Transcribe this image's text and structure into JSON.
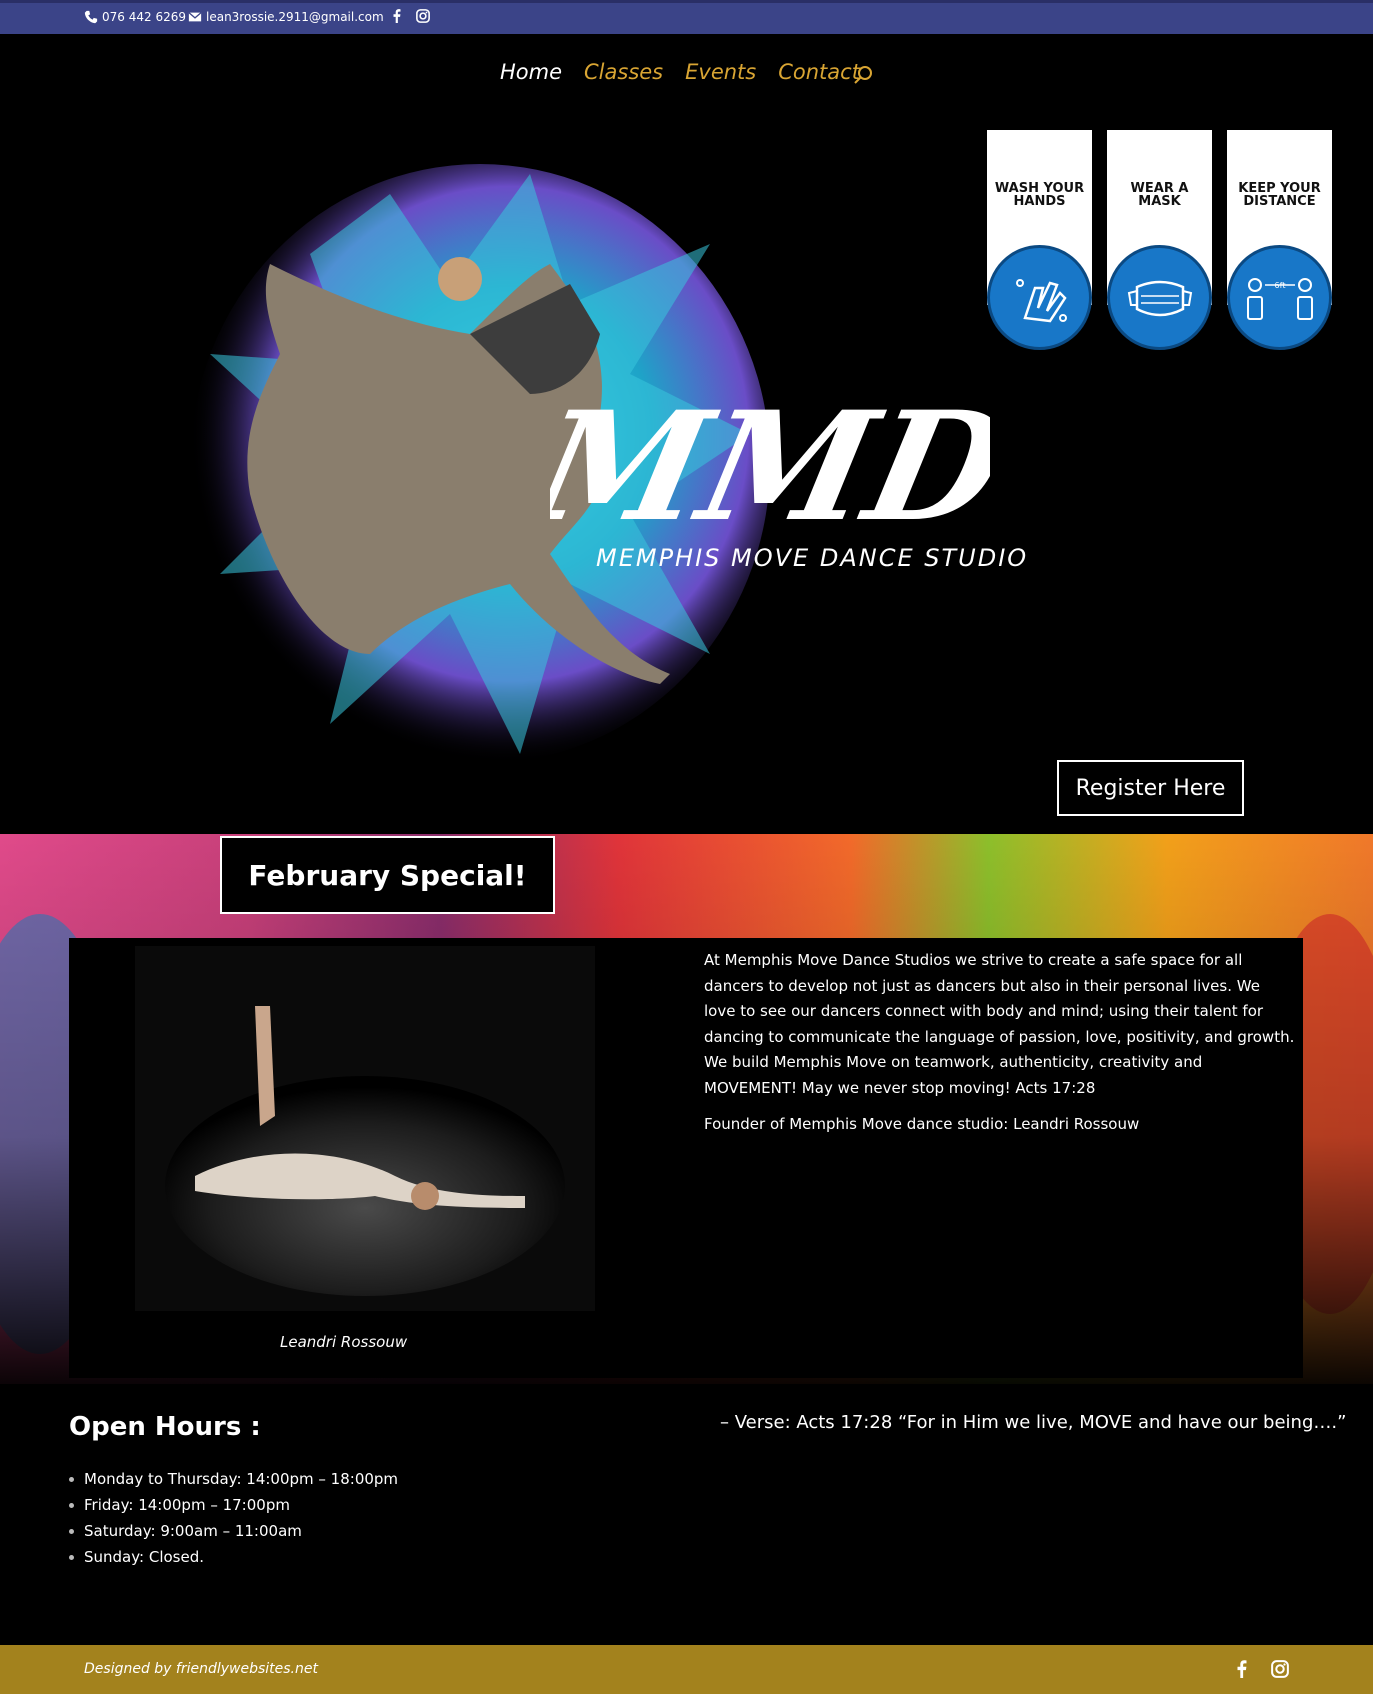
{
  "topbar": {
    "phone": "076 442 6269",
    "email": "lean3rossie.2911@gmail.com",
    "icons": [
      "phone-icon",
      "mail-icon",
      "facebook-icon",
      "instagram-icon"
    ]
  },
  "nav": {
    "links": [
      "Home",
      "Classes",
      "Events",
      "Contact"
    ],
    "active": "Home",
    "search_icon": "search-icon"
  },
  "hero": {
    "brand_logo": "MMDS",
    "subtitle": "MEMPHIS MOVE DANCE STUDIO",
    "covid_tags": [
      {
        "line1": "WASH YOUR",
        "line2": "HANDS",
        "icon": "hands-icon"
      },
      {
        "line1": "WEAR A",
        "line2": "MASK",
        "icon": "mask-icon"
      },
      {
        "line1": "KEEP YOUR",
        "line2": "DISTANCE",
        "icon": "distance-icon",
        "distance_label": "6ft"
      }
    ],
    "register_label": "Register Here"
  },
  "special": {
    "label": "February Special!"
  },
  "about": {
    "text": "At Memphis Move Dance Studios we strive to create a safe space for all dancers to develop not just as dancers but also in their personal lives. We love to see our dancers connect with body and mind; using their talent for dancing to communicate the language of passion, love, positivity, and growth. We build Memphis Move on teamwork, authenticity, creativity and MOVEMENT! May we never stop moving! Acts 17:28",
    "founder": "Founder of Memphis Move dance studio: Leandri Rossouw",
    "caption": "Leandri Rossouw"
  },
  "hours": {
    "title": "Open Hours :",
    "items": [
      "Monday to Thursday: 14:00pm – 18:00pm",
      "Friday: 14:00pm – 17:00pm",
      "Saturday: 9:00am – 11:00am",
      "Sunday: Closed."
    ]
  },
  "verse": "– Verse: Acts 17:28 “For in Him we live, MOVE and have our being….”",
  "footer": {
    "credit": "Designed by friendlywebsites.net"
  },
  "colors": {
    "topbar": "#3b4488",
    "nav_link": "#d9a533",
    "covid_blue": "#1877c8",
    "footer": "#a3821d"
  }
}
